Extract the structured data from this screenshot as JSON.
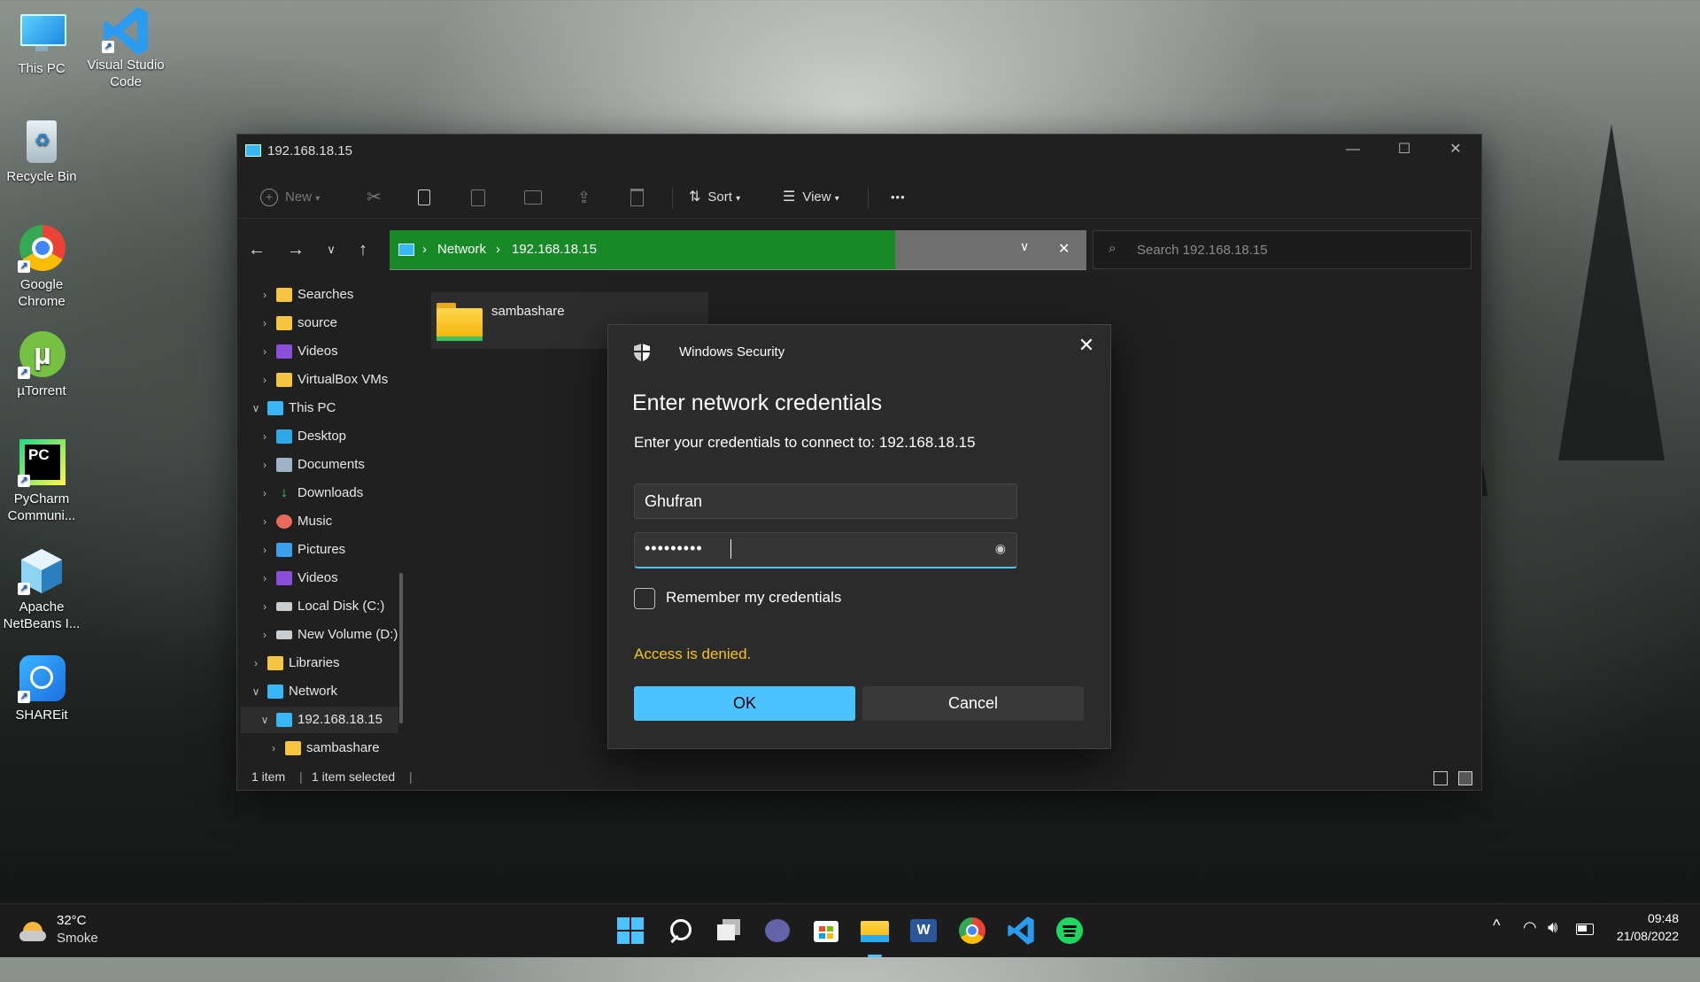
{
  "desktop": {
    "icons": [
      {
        "label": "This PC"
      },
      {
        "label": "Visual Studio Code"
      },
      {
        "label": "Recycle Bin"
      },
      {
        "label": "Google Chrome"
      },
      {
        "label": "µTorrent"
      },
      {
        "label": "PyCharm Communi..."
      },
      {
        "label": "Apache NetBeans I..."
      },
      {
        "label": "SHAREit"
      }
    ]
  },
  "explorer": {
    "title": "192.168.18.15",
    "window_controls": {
      "minimize": "—",
      "maximize": "☐",
      "close": "✕"
    },
    "toolbar": {
      "new_label": "New",
      "sort_label": "Sort",
      "view_label": "View",
      "more_label": "•••"
    },
    "address": {
      "crumbs": [
        "Network",
        "192.168.18.15"
      ],
      "separator": "›"
    },
    "search_placeholder": "Search 192.168.18.15",
    "sidebar": [
      {
        "label": "Searches"
      },
      {
        "label": "source"
      },
      {
        "label": "Videos"
      },
      {
        "label": "VirtualBox VMs"
      },
      {
        "label": "This PC"
      },
      {
        "label": "Desktop"
      },
      {
        "label": "Documents"
      },
      {
        "label": "Downloads"
      },
      {
        "label": "Music"
      },
      {
        "label": "Pictures"
      },
      {
        "label": "Videos"
      },
      {
        "label": "Local Disk (C:)"
      },
      {
        "label": "New Volume (D:)"
      },
      {
        "label": "Libraries"
      },
      {
        "label": "Network"
      },
      {
        "label": "192.168.18.15"
      },
      {
        "label": "sambashare"
      }
    ],
    "content_items": [
      {
        "label": "sambashare"
      }
    ],
    "status": {
      "count": "1 item",
      "selected": "1 item selected",
      "divider": "|"
    }
  },
  "dialog": {
    "title": "Windows Security",
    "heading": "Enter network credentials",
    "description": "Enter your credentials to connect to: 192.168.18.15",
    "username_value": "Ghufran",
    "password_value": "•••••••••",
    "remember_label": "Remember my credentials",
    "error_text": "Access is denied.",
    "ok_label": "OK",
    "cancel_label": "Cancel",
    "close_glyph": "✕"
  },
  "taskbar": {
    "weather_temp": "32°C",
    "weather_desc": "Smoke",
    "time": "09:48",
    "date": "21/08/2022",
    "tray_chevron": "^"
  },
  "colors": {
    "address_fill": "#178a27",
    "ok_button": "#4cc2ff",
    "error_text": "#f5c518"
  }
}
